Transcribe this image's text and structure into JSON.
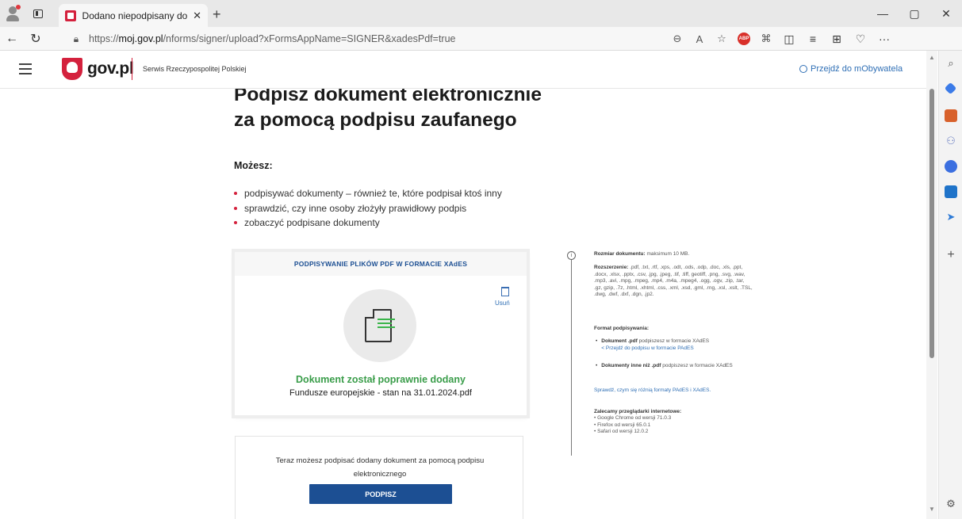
{
  "browser": {
    "tab_title": "Dodano niepodpisany dokument",
    "url_host": "moj.gov.pl",
    "url_prefix": "https://",
    "url_path": "/nforms/signer/upload?xFormsAppName=SIGNER&xadesPdf=true",
    "new_tab": "+",
    "close_tab": "✕",
    "window_minimize": "—",
    "window_restore": "▢",
    "window_close": "✕",
    "back": "←",
    "refresh": "↻",
    "more": "···",
    "abp_label": "ABP"
  },
  "header": {
    "logo_text": "gov.pl",
    "service_name": "Serwis Rzeczypospolitej Polskiej",
    "mobywatel_link": "Przejdź do mObywatela"
  },
  "main": {
    "title_line1": "Podpisz dokument elektronicznie",
    "title_line2": "za pomocą podpisu zaufanego",
    "can_title": "Możesz:",
    "capabilities": [
      "podpisywać dokumenty – również te, które podpisał ktoś inny",
      "sprawdzić, czy inne osoby złożyły prawidłowy podpis",
      "zobaczyć podpisane dokumenty"
    ]
  },
  "upload": {
    "title": "PODPISYWANIE PLIKÓW PDF W FORMACIE XAdES",
    "delete_label": "Usuń",
    "success_message": "Dokument został poprawnie dodany",
    "file_name": "Fundusze europejskie - stan na 31.01.2024.pdf"
  },
  "sign": {
    "text": "Teraz możesz podpisać dodany dokument za pomocą podpisu elektronicznego",
    "button_label": "PODPISZ"
  },
  "info": {
    "size_label": "Rozmiar dokumentu:",
    "size_value": "maksimum 10 MB.",
    "ext_label": "Rozszerzenie:",
    "ext_value": ".pdf, .txt, .rtf, .xps, .odt, .ods, .odp, .doc, .xls, .ppt, .docx, .xlsx, .pptx, .csv, .jpg, .jpeg, .tif, .tiff, geotiff, .png, .svg, .wav, .mp3, .avi, .mpg, .mpeg, .mp4, .m4a, .mpeg4, .ogg, .ogv, .zip, .tar, .gz, gzip, .7z, .html, .xhtml, .css, .xml, .xsd, .gml, .rng, .xsl, .xslt, .TSL, .dwg, .dwf, .dxf, .dgn, .jp2.",
    "format_title": "Format podpisywania:",
    "pdf_bold": "Dokument .pdf",
    "pdf_text": "podpiszesz w formacie XAdES",
    "pades_link": "< Przejdź do podpisu w formacie PAdES",
    "other_bold": "Dokumenty inne niż .pdf",
    "other_text": "podpiszesz w formacie XAdES",
    "compare_link": "Sprawdź, czym się różnią formaty PAdES i XAdES.",
    "browsers_title": "Zalecamy przeglądarki internetowe:",
    "browsers": [
      "• Google Chrome od wersji 71.0.3",
      "• Firefox od wersji 65.0.1",
      "• Safari od wersji 12.0.2"
    ]
  }
}
